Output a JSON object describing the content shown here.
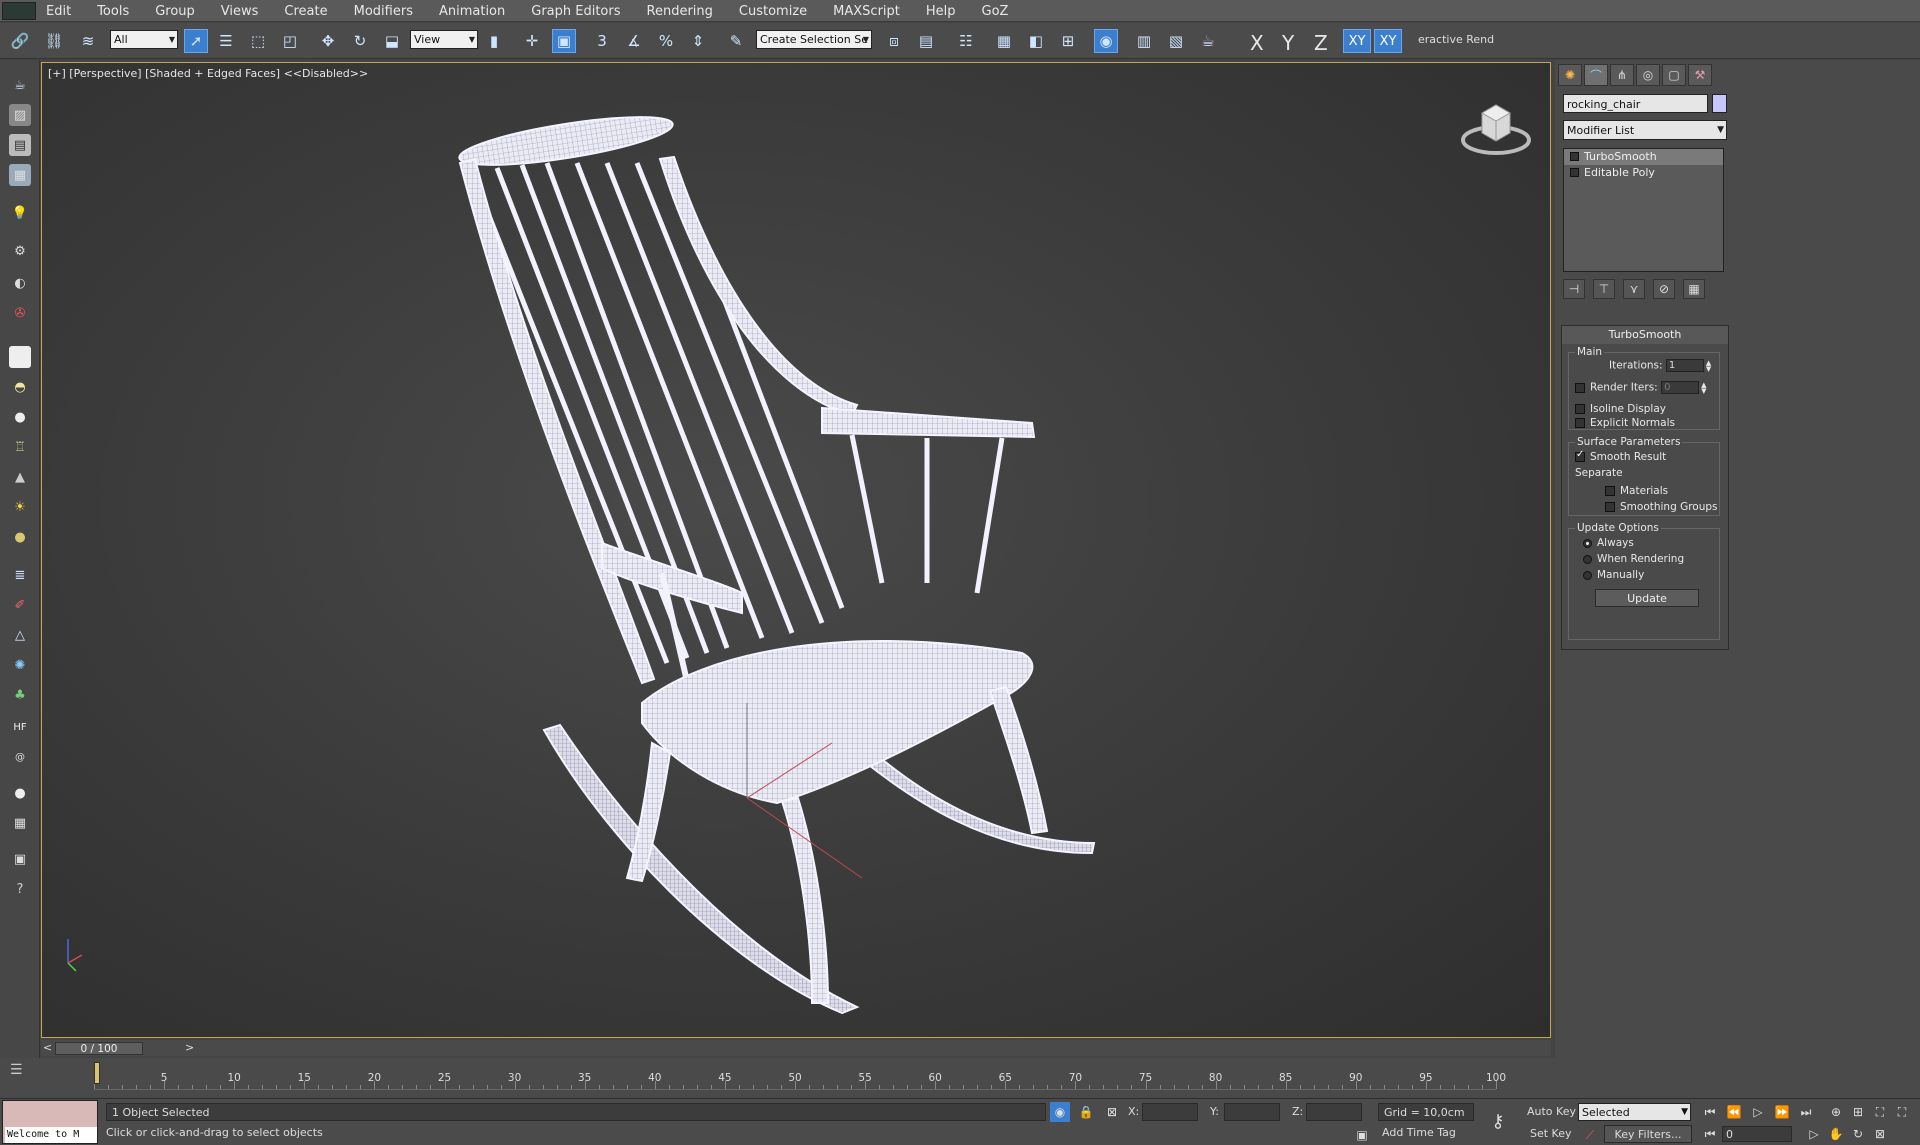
{
  "menu": [
    "Edit",
    "Tools",
    "Group",
    "Views",
    "Create",
    "Modifiers",
    "Animation",
    "Graph Editors",
    "Rendering",
    "Customize",
    "MAXScript",
    "Help",
    "GoZ"
  ],
  "toolbar": {
    "selection_filter": "All",
    "ref_coord": "View",
    "named_selection": "Create Selection Se",
    "axis_x": "X",
    "axis_y": "Y",
    "axis_z": "Z",
    "axis_xy": "XY",
    "axis_xy2": "XY",
    "interactive_render": "eractive Rend"
  },
  "viewport": {
    "label": "[+] [Perspective] [Shaded + Edged Faces]  <<Disabled>>"
  },
  "command_panel": {
    "object_name": "rocking_chair",
    "object_color": "#c8c8ff",
    "modifier_list": "Modifier List",
    "stack": [
      "TurboSmooth",
      "Editable Poly"
    ],
    "turbosmooth": {
      "title": "TurboSmooth",
      "main_group": "Main",
      "iterations_label": "Iterations:",
      "iterations_value": "1",
      "render_iters_label": "Render Iters:",
      "render_iters_value": "0",
      "isoline_display": "Isoline Display",
      "explicit_normals": "Explicit Normals",
      "surface_group": "Surface Parameters",
      "smooth_result": "Smooth Result",
      "separate": "Separate",
      "materials": "Materials",
      "smoothing_groups": "Smoothing Groups",
      "update_group": "Update Options",
      "always": "Always",
      "when_rendering": "When Rendering",
      "manually": "Manually",
      "update_button": "Update"
    }
  },
  "timeline": {
    "slider_label": "0 / 100",
    "ticks": [
      "5",
      "10",
      "15",
      "20",
      "25",
      "30",
      "35",
      "40",
      "45",
      "50",
      "55",
      "60",
      "65",
      "70",
      "75",
      "80",
      "85",
      "90",
      "95",
      "100"
    ]
  },
  "status": {
    "welcome": "Welcome to M",
    "objects_selected": "1 Object Selected",
    "prompt": "Click or click-and-drag to select objects",
    "x_label": "X:",
    "y_label": "Y:",
    "z_label": "Z:",
    "grid": "Grid = 10,0cm",
    "add_time_tag": "Add Time Tag",
    "auto_key": "Auto Key",
    "set_key": "Set Key",
    "selected_drop": "Selected",
    "key_filters": "Key Filters...",
    "frame": "0"
  }
}
